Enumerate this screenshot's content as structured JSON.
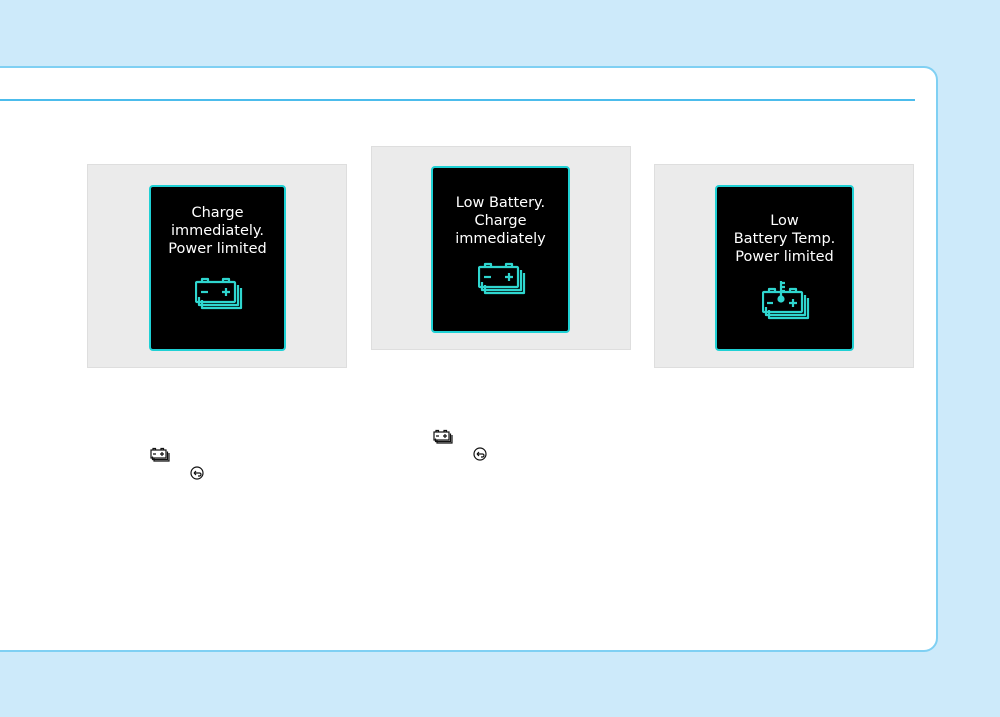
{
  "colors": {
    "background": "#cdeafa",
    "page": "#ffffff",
    "accent_rule": "#4cbcec",
    "screen_border": "#1fd0d4",
    "screen_icon": "#2fd6cf",
    "screen_bg": "#000000"
  },
  "messages": [
    {
      "lines": [
        "Charge",
        "immediately.",
        "Power limited"
      ],
      "icon": "battery-stack-icon"
    },
    {
      "lines": [
        "Low Battery.",
        "Charge",
        "immediately"
      ],
      "icon": "battery-stack-icon"
    },
    {
      "lines": [
        "Low",
        "Battery Temp.",
        "Power limited"
      ],
      "icon": "battery-temperature-icon"
    }
  ],
  "inline_icons": [
    "battery-stack-icon",
    "return-button-icon",
    "battery-stack-icon",
    "return-button-icon"
  ]
}
